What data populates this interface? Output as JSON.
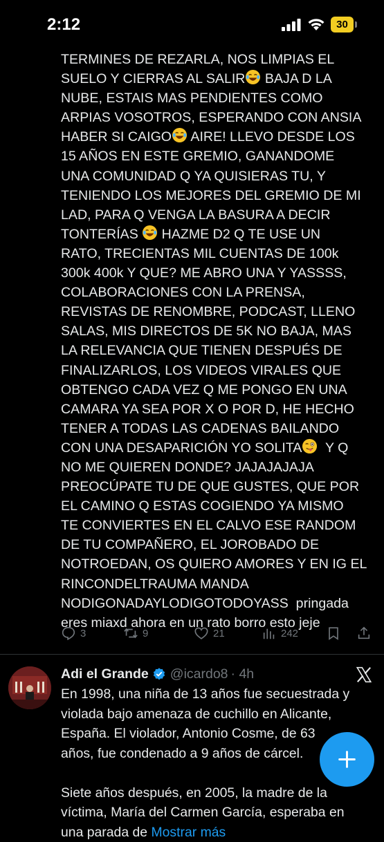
{
  "status_bar": {
    "time": "2:12",
    "battery_level": "30",
    "accent_color": "#f2cd22"
  },
  "tweet": {
    "text_lines": [
      "TERMINES DE REZARLA, NOS LIMPIAS EL",
      "SUELO Y CIERRAS AL SALIR",
      " BAJA D LA",
      "NUBE, ESTAIS MAS PENDIENTES COMO",
      "ARPIAS VOSOTROS, ESPERANDO CON ANSIA",
      "HABER SI CAIGO",
      " AIRE! LLEVO DESDE LOS",
      "15 AÑOS EN ESTE GREMIO, GANANDOME",
      "UNA COMUNIDAD Q YA QUISIERAS TU, Y",
      "TENIENDO LOS MEJORES DEL GREMIO DE MI",
      "LAD, PARA Q VENGA LA BASURA A DECIR",
      "TONTERÍAS ",
      " HAZME D2 Q TE USE UN",
      "RATO, TRECIENTAS MIL CUENTAS DE 100k",
      "300k 400k Y QUE? ME ABRO UNA Y YASSSS,",
      "COLABORACIONES CON LA PRENSA,",
      "REVISTAS DE RENOMBRE, PODCAST, LLENO",
      "SALAS, MIS DIRECTOS DE 5K NO BAJA, MAS",
      "LA RELEVANCIA QUE TIENEN DESPUÉS DE",
      "FINALIZARLOS, LOS VIDEOS VIRALES QUE",
      "OBTENGO CADA VEZ Q ME PONGO EN UNA",
      "CAMARA YA SEA POR X O POR D, HE HECHO",
      "TENER A TODAS LAS CADENAS BAILANDO",
      "CON UNA DESAPARICIÓN YO SOLITA",
      "  Y Q",
      "NO ME QUIEREN DONDE? JAJAJAJAJA",
      "PREOCÚPATE TU DE QUE GUSTES, QUE POR",
      "EL CAMINO Q ESTAS COGIENDO YA MISMO",
      "TE CONVIERTES EN EL CALVO ESE RANDOM",
      "DE TU COMPAÑERO, EL JOROBADO DE",
      "NOTROEDAN, OS QUIERO AMORES Y EN IG EL",
      "RINCONDELTRAUMA MANDA",
      "NODIGONADAYLODIGOTODOYASS  pringada",
      "eres miaxd ahora en un rato borro esto jeje"
    ],
    "emojis": [
      "laughing-crying-emoji",
      "laughing-crying-emoji",
      "laughing-crying-emoji",
      "winking-tongue-emoji"
    ],
    "actions": {
      "replies": "3",
      "reposts": "9",
      "likes": "21",
      "views": "242"
    }
  },
  "tweet2": {
    "display_name": "Adi el Grande",
    "handle": "@icardo8",
    "time": "· 4h",
    "body_lines": [
      "En 1998, una niña de 13 años fue secuestrada y",
      "violada bajo amenaza de cuchillo en Alicante,",
      "España. El violador, Antonio Cosme, de 63",
      "años, fue condenado a 9 años de cárcel.",
      "",
      "Siete años después, en 2005, la madre de la",
      "víctima, María del Carmen García, esperaba en",
      "una parada de "
    ],
    "show_more": "Mostrar más",
    "verified_color": "#1d9bf0"
  },
  "fab": {
    "icon": "plus-icon",
    "color": "#1d9bf0"
  }
}
